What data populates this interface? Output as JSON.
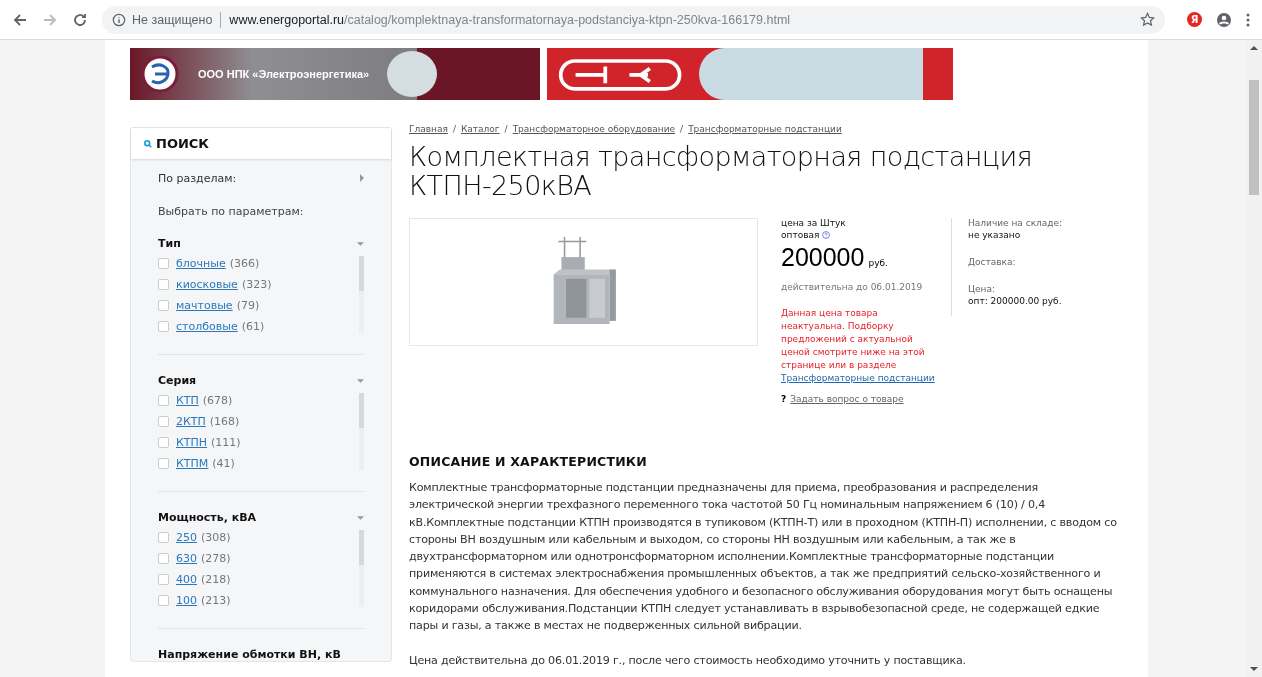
{
  "browser": {
    "security": "Не защищено",
    "url_host": "www.energoportal.ru",
    "url_path": "/catalog/komplektnaya-transformatornaya-podstanciya-ktpn-250kva-166179.html",
    "profile_badge": "Я"
  },
  "banners": {
    "left_text": "ООО НПК «Электроэнергетика»"
  },
  "sidebar": {
    "title": "ПОИСК",
    "sections_label": "По разделам:",
    "params_label": "Выбрать по параметрам:",
    "groups": [
      {
        "title": "Тип",
        "expanded": true,
        "items": [
          {
            "label": "блочные",
            "count": "(366)",
            "checked": false
          },
          {
            "label": "киосковые",
            "count": "(323)",
            "checked": false
          },
          {
            "label": "мачтовые",
            "count": "(79)",
            "checked": false
          },
          {
            "label": "столбовые",
            "count": "(61)",
            "checked": false
          }
        ]
      },
      {
        "title": "Серия",
        "expanded": true,
        "items": [
          {
            "label": "КТП",
            "count": "(678)",
            "checked": false
          },
          {
            "label": "2КТП",
            "count": "(168)",
            "checked": false
          },
          {
            "label": "КТПН",
            "count": "(111)",
            "checked": false
          },
          {
            "label": "КТПМ",
            "count": "(41)",
            "checked": false
          }
        ]
      },
      {
        "title": "Мощность, кВА",
        "expanded": true,
        "items": [
          {
            "label": "250",
            "count": "(308)",
            "checked": false
          },
          {
            "label": "630",
            "count": "(278)",
            "checked": false
          },
          {
            "label": "400",
            "count": "(218)",
            "checked": false
          },
          {
            "label": "100",
            "count": "(213)",
            "checked": false
          }
        ]
      },
      {
        "title": "Напряжение обмотки ВН, кВ"
      }
    ]
  },
  "breadcrumbs": [
    "Главная",
    "Каталог",
    "Трансформаторное оборудование",
    "Трансформаторные подстанции"
  ],
  "breadcrumb_separator": "/",
  "title": "Комплектная трансформаторная подстанция КТПН-250кВА",
  "price": {
    "unit_label": "цена за Штук",
    "type_label": "оптовая",
    "amount": "200000",
    "currency": "руб.",
    "valid": "действительна до 06.01.2019",
    "warning": "Данная цена товара неактуальна. Подборку предложений с актуальной ценой смотрите ниже на этой странице или в разделе",
    "warning_link": "Трансформаторные подстанции",
    "question_mark": "?",
    "question_link": "Задать вопрос о товаре"
  },
  "info": [
    {
      "label": "Наличие на складе:",
      "value": "не указано"
    },
    {
      "label": "Доставка:"
    },
    {
      "label": "Цена:",
      "value": "опт: 200000.00 руб."
    }
  ],
  "description": {
    "heading": "ОПИСАНИЕ И ХАРАКТЕРИСТИКИ",
    "text": "Комплектные трансформаторные подстанции предназначены для приема, преобразования и распределения электрической энергии трехфазного переменного тока частотой 50 Гц номинальным напряжением 6 (10) / 0,4 кВ.Комплектные подстанции КТПН производятся в тупиковом (КТПН-Т) или в проходном (КТПН-П) исполнении, с вводом со стороны ВН воздушным или кабельным и выходом, со стороны НН воздушным или кабельным, а так же в двухтрансформаторном или однотронсформаторном исполнении.Комплектные трансформаторные подстанции применяются в системах электроснабжения промышленных объектов, а так же предприятий сельско-хозяйственного и коммунального назначения. Для обеспечения удобного и безопасного обслуживания оборудования могут быть оснащены коридорами обслуживания.Подстанции КТПН следует устанавливать в взрывобезопасной среде, не содержащей едкие пары и газы, а также в местах не подверженных сильной вибрации.",
    "note": "Цена действительна до 06.01.2019 г., после чего стоимость необходимо уточнить у поставщика."
  }
}
